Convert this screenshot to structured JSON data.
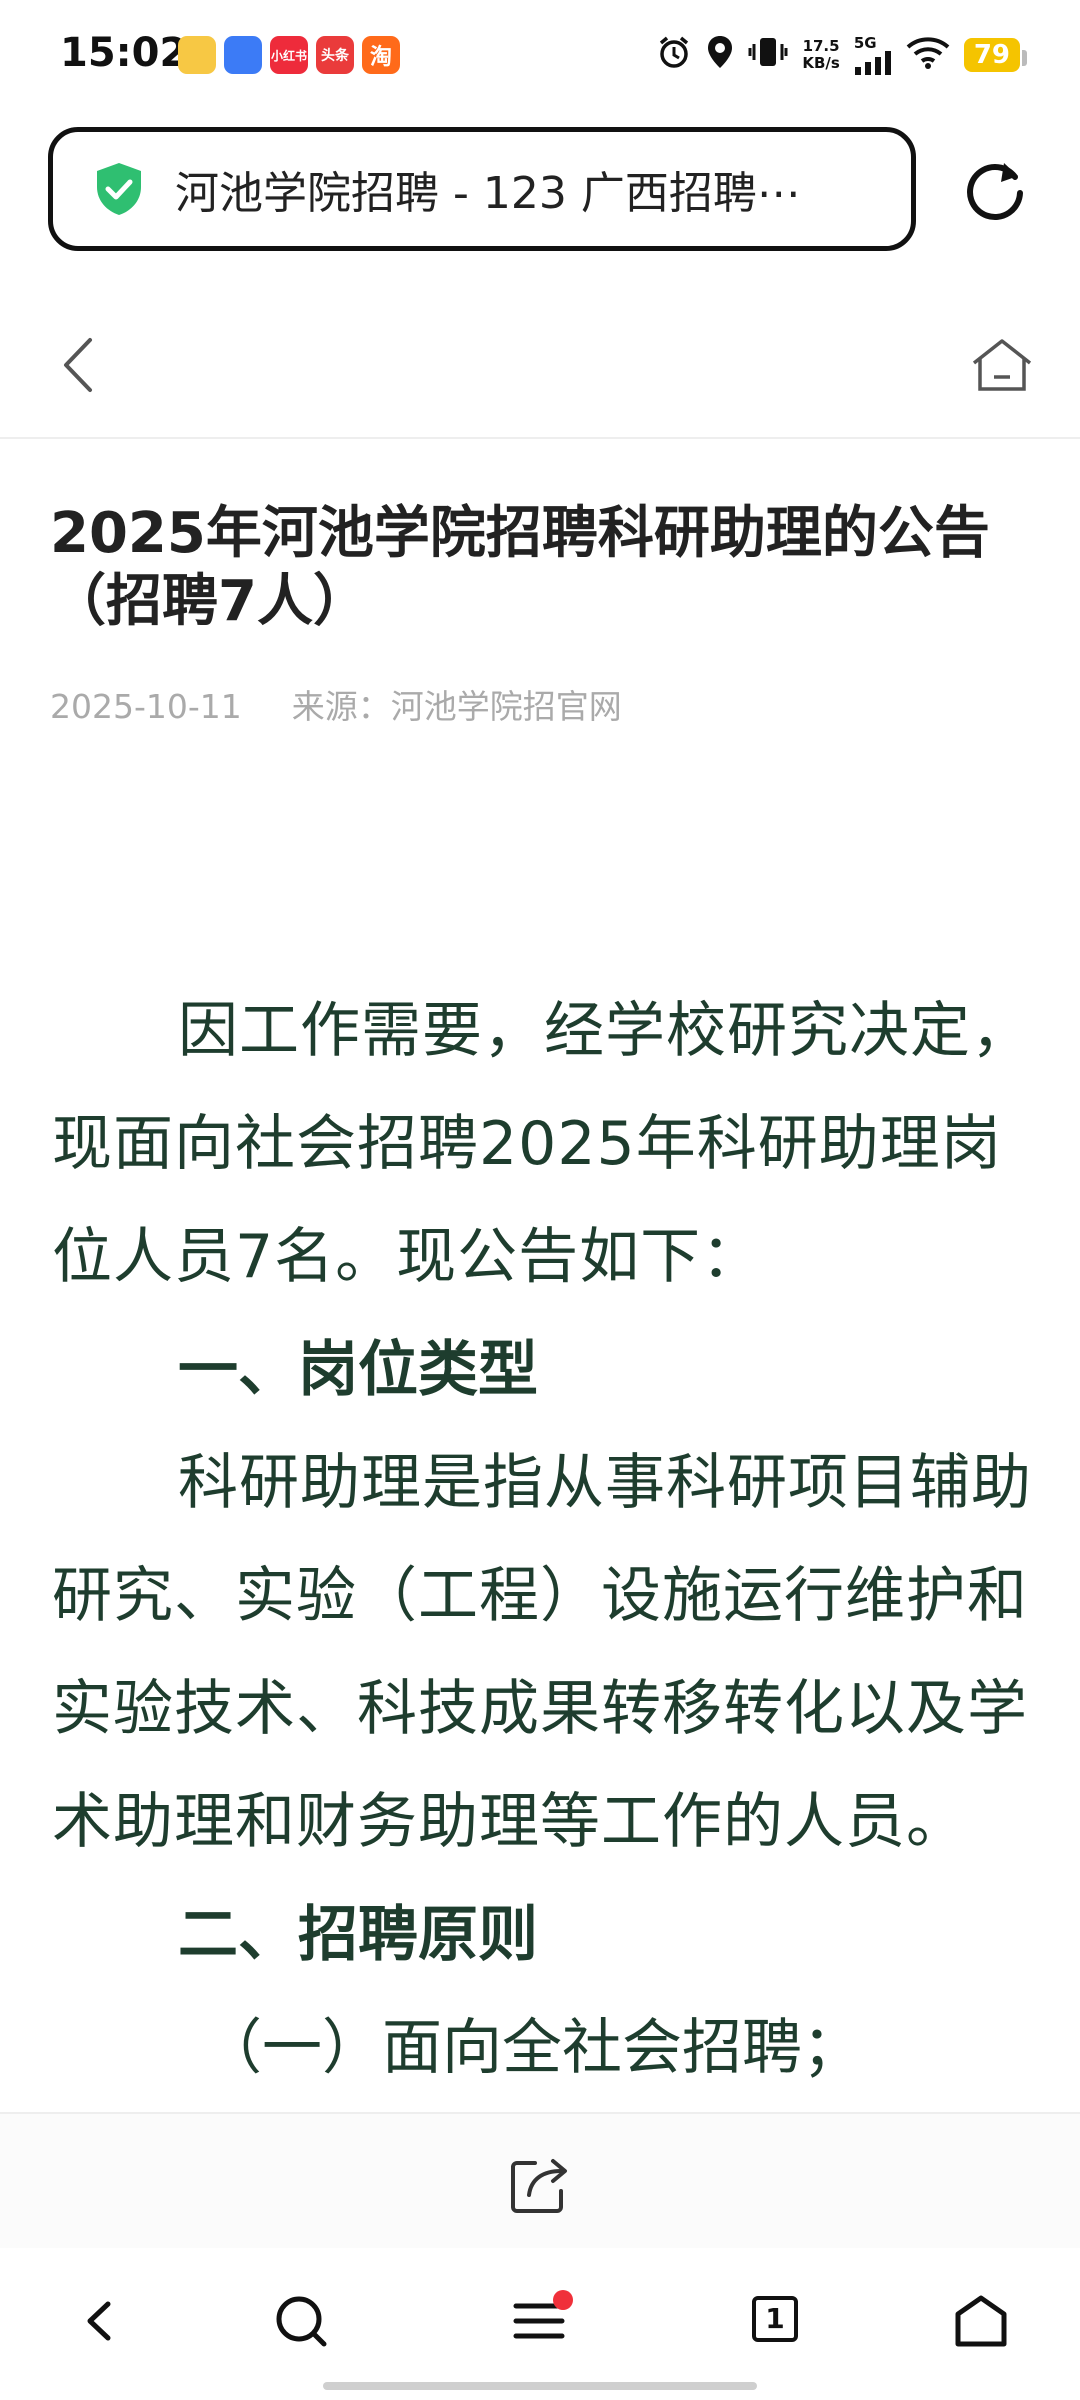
{
  "status_bar": {
    "time": "15:02",
    "apps": [
      {
        "name": "wallet-app",
        "label": "",
        "color": "#f7c844"
      },
      {
        "name": "browser-app",
        "label": "",
        "color": "#3c7bf6"
      },
      {
        "name": "xiaohongshu-app",
        "label": "小红书",
        "color": "#ee2b3b"
      },
      {
        "name": "toutiao-app",
        "label": "头条",
        "color": "#ea3b3b"
      },
      {
        "name": "taobao-app",
        "label": "淘",
        "color": "#ff6a1a"
      }
    ],
    "network_speed_value": "17.5",
    "network_speed_unit": "KB/s",
    "network_type": "5G",
    "battery": "79"
  },
  "browser": {
    "url_title": "河池学院招聘 - 123 广西招聘⋯",
    "tab_count": "1"
  },
  "article": {
    "title": "2025年河池学院招聘科研助理的公告（招聘7人）",
    "date": "2025-10-11",
    "source": "来源：河池学院招官网",
    "intro": "因工作需要，经学校研究决定，现面向社会招聘2025年科研助理岗位人员7名。现公告如下：",
    "section1_heading": "一、岗位类型",
    "section1_text": "科研助理是指从事科研项目辅助研究、实验（工程）设施运行维护和实验技术、科技成果转移转化以及学术助理和财务助理等工作的人员。",
    "section2_heading": "二、招聘原则",
    "section2_item1": "（一）面向全社会招聘；"
  },
  "colors": {
    "body_text": "#1e3d2e",
    "shield": "#2fbf71",
    "notification_dot": "#f0303a",
    "battery": "#f5c400"
  }
}
